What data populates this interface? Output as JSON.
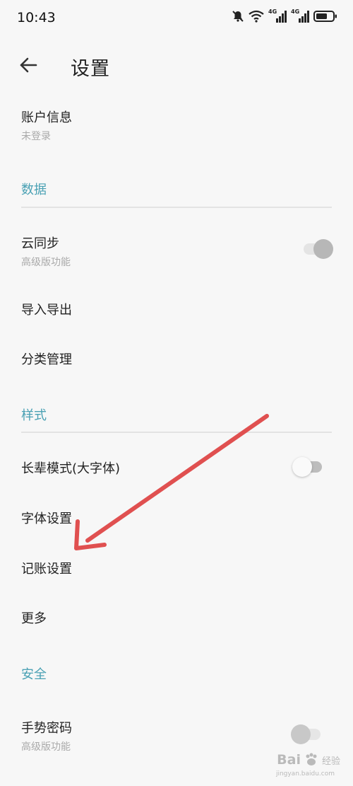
{
  "status_bar": {
    "time": "10:43",
    "signal_1": "4G",
    "signal_2": "4G"
  },
  "header": {
    "back_label": "←",
    "title": "设置"
  },
  "account": {
    "title": "账户信息",
    "subtitle": "未登录"
  },
  "sections": {
    "data": {
      "title": "数据",
      "items": [
        {
          "title": "云同步",
          "subtitle": "高级版功能",
          "toggle": "on-disabled"
        },
        {
          "title": "导入导出"
        },
        {
          "title": "分类管理"
        }
      ]
    },
    "style": {
      "title": "样式",
      "items": [
        {
          "title": "长辈模式(大字体)",
          "toggle": "off"
        },
        {
          "title": "字体设置"
        },
        {
          "title": "记账设置"
        },
        {
          "title": "更多"
        }
      ]
    },
    "security": {
      "title": "安全",
      "items": [
        {
          "title": "手势密码",
          "subtitle": "高级版功能",
          "toggle": "off-disabled"
        }
      ]
    }
  },
  "colors": {
    "accent": "#4aa1b4",
    "annotation_arrow": "#e05050",
    "background": "#f7f7f7"
  },
  "watermark": {
    "brand": "Bai",
    "brand_end": "经验",
    "url": "jingyan.baidu.com"
  }
}
